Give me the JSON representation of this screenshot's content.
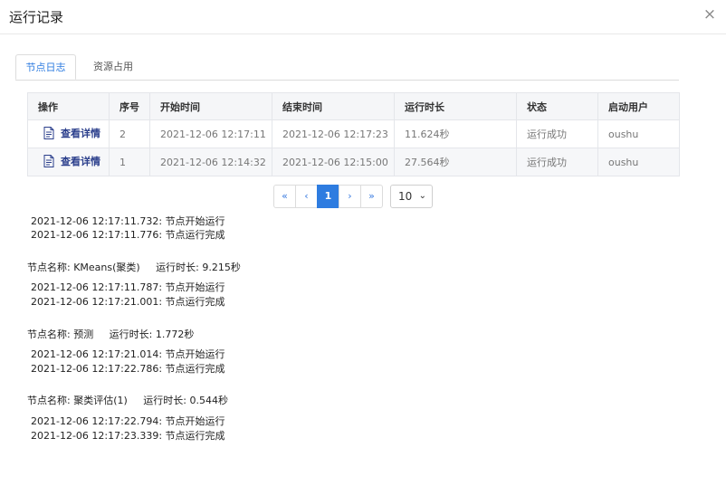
{
  "dialog": {
    "title": "运行记录",
    "close_icon": "×"
  },
  "tabs": [
    {
      "label": "节点日志",
      "active": true
    },
    {
      "label": "资源占用",
      "active": false
    }
  ],
  "table": {
    "columns": [
      "操作",
      "序号",
      "开始时间",
      "结束时间",
      "运行时长",
      "状态",
      "启动用户"
    ],
    "rows": [
      {
        "action": "查看详情",
        "index": "2",
        "start": "2021-12-06 12:17:11",
        "end": "2021-12-06 12:17:23",
        "duration": "11.624秒",
        "status": "运行成功",
        "user": "oushu"
      },
      {
        "action": "查看详情",
        "index": "1",
        "start": "2021-12-06 12:14:32",
        "end": "2021-12-06 12:15:00",
        "duration": "27.564秒",
        "status": "运行成功",
        "user": "oushu"
      }
    ]
  },
  "pagination": {
    "first": "«",
    "prev": "‹",
    "current": "1",
    "next": "›",
    "last": "»",
    "page_size": "10"
  },
  "logs": {
    "first_block": [
      "2021-12-06 12:17:11.732: 节点开始运行",
      "2021-12-06 12:17:11.776: 节点运行完成"
    ],
    "nodes": [
      {
        "header": "节点名称: KMeans(聚类)     运行时长: 9.215秒",
        "lines": [
          "2021-12-06 12:17:11.787: 节点开始运行",
          "2021-12-06 12:17:21.001: 节点运行完成"
        ]
      },
      {
        "header": "节点名称: 预测     运行时长: 1.772秒",
        "lines": [
          "2021-12-06 12:17:21.014: 节点开始运行",
          "2021-12-06 12:17:22.786: 节点运行完成"
        ]
      },
      {
        "header": "节点名称: 聚类评估(1)     运行时长: 0.544秒",
        "lines": [
          "2021-12-06 12:17:22.794: 节点开始运行",
          "2021-12-06 12:17:23.339: 节点运行完成"
        ]
      }
    ]
  }
}
